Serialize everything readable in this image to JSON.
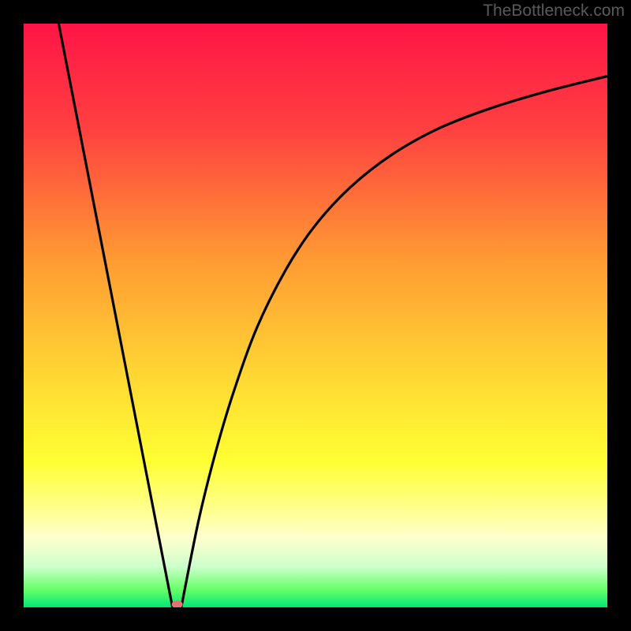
{
  "watermark": "TheBottleneck.com",
  "chart_data": {
    "type": "line",
    "title": "",
    "xlabel": "",
    "ylabel": "",
    "xlim": [
      0,
      100
    ],
    "ylim": [
      0,
      100
    ],
    "gradient_stops": [
      {
        "offset": 0,
        "color": "#ff1547"
      },
      {
        "offset": 18,
        "color": "#ff4040"
      },
      {
        "offset": 40,
        "color": "#ff9933"
      },
      {
        "offset": 60,
        "color": "#ffd633"
      },
      {
        "offset": 75,
        "color": "#ffff33"
      },
      {
        "offset": 82,
        "color": "#ffff80"
      },
      {
        "offset": 88,
        "color": "#ffffcc"
      },
      {
        "offset": 93,
        "color": "#ccffcc"
      },
      {
        "offset": 97,
        "color": "#66ff66"
      },
      {
        "offset": 100,
        "color": "#00e676"
      }
    ],
    "series": [
      {
        "name": "curve-left",
        "type": "line",
        "x": [
          6,
          25.5
        ],
        "y": [
          100,
          0
        ],
        "shape": "linear"
      },
      {
        "name": "curve-right",
        "type": "line",
        "x": [
          27,
          30,
          33,
          36,
          40,
          45,
          50,
          56,
          63,
          71,
          80,
          90,
          100
        ],
        "y": [
          0,
          15,
          27,
          37,
          48,
          58,
          65.5,
          72,
          77.5,
          82,
          85.5,
          88.5,
          91
        ],
        "shape": "spline"
      }
    ],
    "marker": {
      "x": 26.3,
      "y": 0.5,
      "color": "#e57373",
      "rx": 7,
      "ry": 5
    }
  }
}
